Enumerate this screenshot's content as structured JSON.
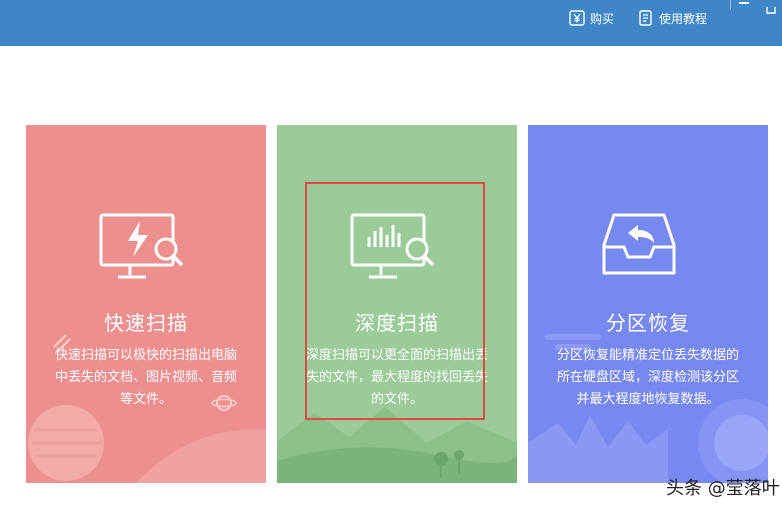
{
  "toolbar": {
    "buy_label": "购买",
    "tutorial_label": "使用教程"
  },
  "cards": [
    {
      "id": "quick-scan",
      "title": "快速扫描",
      "description": "快速扫描可以极快的扫描出电脑中丢失的文档、图片视频、音频等文件。",
      "color": "#ee8f8f",
      "icon": "monitor-lightning-search-icon"
    },
    {
      "id": "deep-scan",
      "title": "深度扫描",
      "description": "深度扫描可以更全面的扫描出丢失的文件，最大程度的找回丢失的文件。",
      "color": "#9acb98",
      "icon": "monitor-chart-search-icon",
      "selected": true
    },
    {
      "id": "partition-recovery",
      "title": "分区恢复",
      "description": "分区恢复能精准定位丢失数据的所在硬盘区域，深度检测该分区并最大程度地恢复数据。",
      "color": "#7788f0",
      "icon": "inbox-restore-icon"
    }
  ],
  "colors": {
    "header": "#3f86c8",
    "selection": "#e04b3f"
  },
  "watermark": "头条 @莹落叶"
}
